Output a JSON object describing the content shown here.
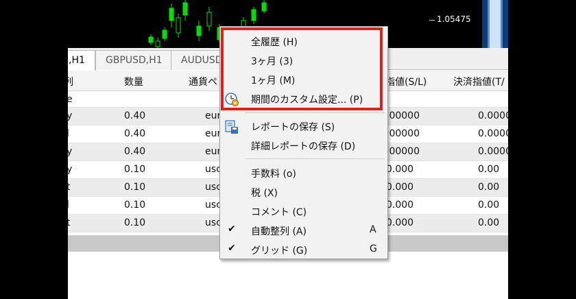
{
  "chart": {
    "price": "1.05475"
  },
  "tabs": [
    {
      "label": ",H1",
      "active": true
    },
    {
      "label": "GBPUSD,H1",
      "active": false
    },
    {
      "label": "AUDUSD",
      "active": false
    }
  ],
  "table": {
    "headers": [
      "列",
      "数量",
      "通貨ペ",
      "指値(S/L)",
      "決済指値(T/"
    ],
    "sub_header": "e",
    "rows": [
      {
        "type": "y",
        "qty": "0.40",
        "pair": "eur",
        "sl": ".00000",
        "tp": "0.0000"
      },
      {
        "type": "l",
        "qty": "0.40",
        "pair": "eur",
        "sl": ".00000",
        "tp": "0.0000"
      },
      {
        "type": "y",
        "qty": "0.40",
        "pair": "eur",
        "sl": ".00000",
        "tp": "0.0000"
      },
      {
        "type": "y",
        "qty": "0.10",
        "pair": "usc",
        "sl": "0.000",
        "tp": "0.00"
      },
      {
        "type": "t",
        "qty": "0.10",
        "pair": "usc",
        "sl": "0.000",
        "tp": "0.00"
      },
      {
        "type": "l",
        "qty": "0.10",
        "pair": "usc",
        "sl": "0.000",
        "tp": "0.00"
      },
      {
        "type": "t",
        "qty": "0.10",
        "pair": "usc",
        "sl": "0.000",
        "tp": "0.00"
      }
    ]
  },
  "menu": {
    "items": [
      {
        "label": "全履歴 (H)"
      },
      {
        "label": "3ヶ月 (3)"
      },
      {
        "label": "1ヶ月 (M)"
      },
      {
        "label": "期間のカスタム設定... (P)",
        "icon": "custom-period-icon"
      },
      {
        "label": "レポートの保存 (S)",
        "icon": "save-report-icon"
      },
      {
        "label": "詳細レポートの保存 (D)"
      },
      {
        "label": "手数料 (o)"
      },
      {
        "label": "税 (X)"
      },
      {
        "label": "コメント (C)"
      },
      {
        "label": "自動整列 (A)",
        "checked": true,
        "shortcut": "A"
      },
      {
        "label": "グリッド (G)",
        "checked": true,
        "shortcut": "G"
      }
    ]
  },
  "colors": {
    "highlight": "#e0201b",
    "candle_up": "#00e000"
  }
}
